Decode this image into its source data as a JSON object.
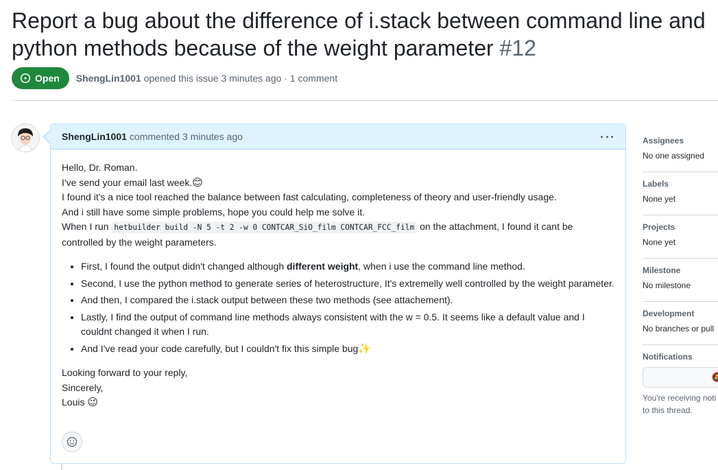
{
  "issue": {
    "title": "Report a bug about the difference of i.stack between command line and python methods because of the weight parameter",
    "number": "#12",
    "state": "Open",
    "author": "ShengLin1001",
    "opened_text": "opened this issue 3 minutes ago · 1 comment"
  },
  "comment": {
    "author": "ShengLin1001",
    "action_time": "commented 3 minutes ago",
    "lines": [
      "Hello, Dr. Roman.",
      "I've send your email last week.",
      "I found it's a nice tool reached the balance between fast calculating, completeness of theory and user-friendly usage.",
      "And i still have some simple problems, hope you could help me solve it."
    ],
    "run_prefix": "When I run",
    "run_code": "hetbuilder build -N 5 -t 2 -w 0 CONTCAR_SiO_film CONTCAR_FCC_film",
    "run_suffix": "on the attachment, I found it cant be controlled by the weight parameters.",
    "bullet1_pre": "First, I found the output didn't changed although",
    "bullet1_bold": "different weight",
    "bullet1_post": ", when i use the command line method.",
    "bullet2": "Second, I use the python method to generate series of heterostructure, It's extremelly well controlled by the weight parameter.",
    "bullet3": "And then, I compared the i.stack output between these two methods (see attachement).",
    "bullet4": "Lastly, I find the output of command line methods always consistent with the w = 0.5. It seems like a default value and I couldnt changed it when I run.",
    "bullet5": "And I've read your code carefully, but I couldn't fix this simple bug",
    "closing1": "Looking forward to your reply,",
    "closing2": "Sincerely,",
    "closing3": "Louis",
    "emoji_smile": "😊",
    "emoji_sparkles": "✨",
    "emoji_wink": "😉"
  },
  "sidebar": {
    "assignees_label": "Assignees",
    "assignees_value": "No one assigned",
    "labels_label": "Labels",
    "labels_value": "None yet",
    "projects_label": "Projects",
    "projects_value": "None yet",
    "milestone_label": "Milestone",
    "milestone_value": "No milestone",
    "development_label": "Development",
    "development_value": "No branches or pull",
    "notifications_label": "Notifications",
    "notifications_text1": "You're receiving noti",
    "notifications_text2": "to this thread."
  },
  "icons": {
    "state": "issue-opened-icon",
    "kebab": "kebab-horizontal-icon",
    "reaction": "smiley-icon",
    "notifications": "bell-slash-icon"
  },
  "colors": {
    "open_green": "#1f883d",
    "header_blue": "#ddf4ff",
    "border": "#d1d9e0",
    "muted": "#59636e"
  }
}
